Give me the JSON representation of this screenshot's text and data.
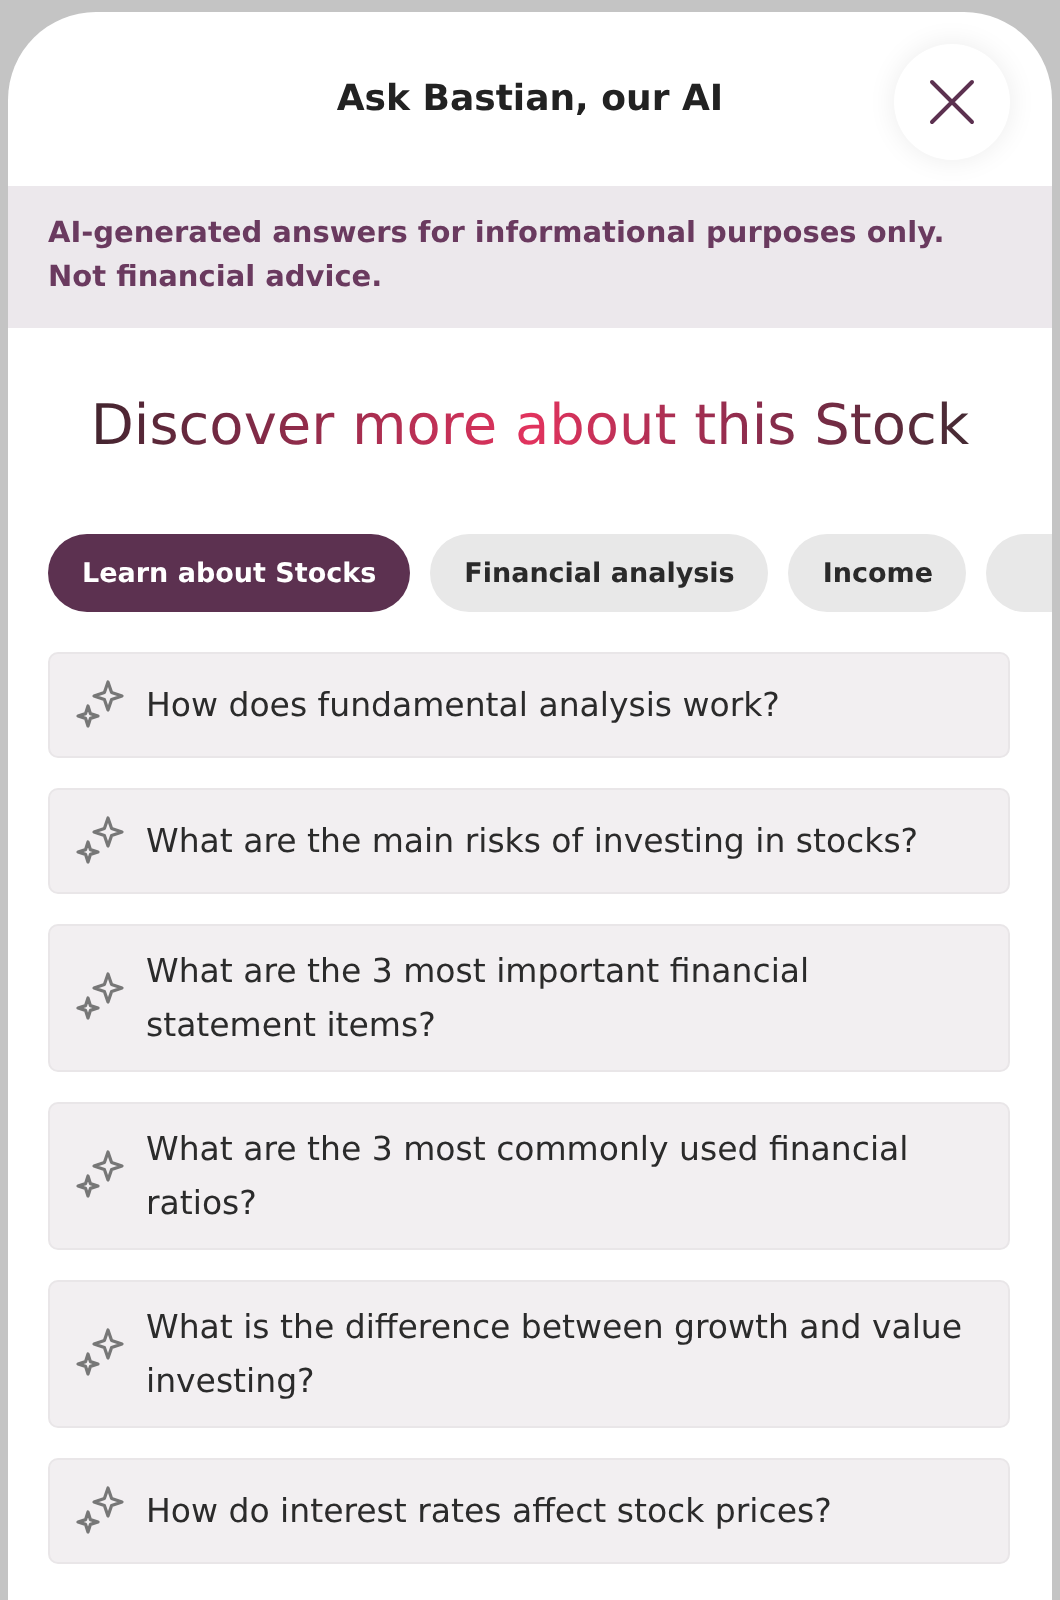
{
  "header": {
    "title": "Ask Bastian, our AI"
  },
  "disclaimer": "AI-generated answers for informational purposes only. Not financial advice.",
  "heading": "Discover more about this Stock",
  "tabs": [
    {
      "label": "Learn about Stocks",
      "selected": true
    },
    {
      "label": "Financial analysis",
      "selected": false
    },
    {
      "label": "Income",
      "selected": false
    }
  ],
  "questions": [
    "How does fundamental analysis work?",
    "What are the main risks of investing in stocks?",
    "What are the 3 most important financial statement items?",
    "What are the 3 most commonly used financial ratios?",
    "What is the difference between growth and value investing?",
    "How do interest rates affect stock prices?"
  ]
}
